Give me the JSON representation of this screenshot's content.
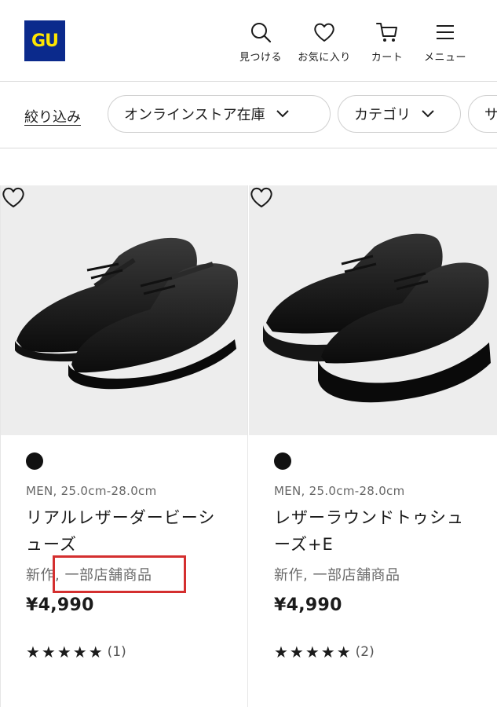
{
  "header": {
    "logo_text": "GU",
    "nav": [
      {
        "label": "見つける",
        "icon": "search-icon"
      },
      {
        "label": "お気に入り",
        "icon": "heart-icon"
      },
      {
        "label": "カート",
        "icon": "cart-icon"
      },
      {
        "label": "メニュー",
        "icon": "hamburger-menu-icon"
      }
    ]
  },
  "filters": {
    "refine_label": "絞り込み",
    "pills": [
      {
        "label": "オンラインストア在庫"
      },
      {
        "label": "カテゴリ"
      },
      {
        "label": "サ"
      }
    ]
  },
  "products": [
    {
      "meta": "MEN, 25.0cm-28.0cm",
      "name": "リアルレザーダービーシューズ",
      "tags": "新作, 一部店舗商品",
      "price": "¥4,990",
      "stars": "★★★★★",
      "review_count": "(1)",
      "swatch_color": "#111111"
    },
    {
      "meta": "MEN, 25.0cm-28.0cm",
      "name": "レザーラウンドトゥシューズ+E",
      "tags": "新作, 一部店舗商品",
      "price": "¥4,990",
      "stars": "★★★★★",
      "review_count": "(2)",
      "swatch_color": "#111111"
    }
  ],
  "colors": {
    "logo_bg": "#0b2a8c",
    "logo_text": "#ffe600",
    "highlight": "#d42f2f",
    "image_bg": "#ededed"
  }
}
